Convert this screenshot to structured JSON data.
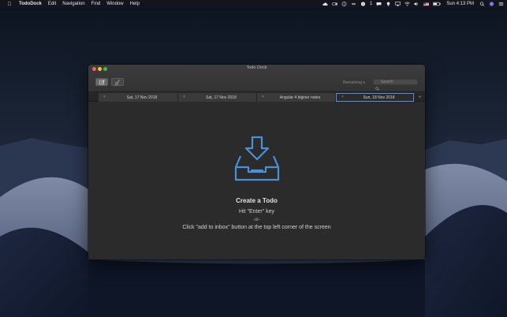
{
  "menubar": {
    "app_name": "TodoDock",
    "menus": [
      "Edit",
      "Navigation",
      "Find",
      "Window",
      "Help"
    ],
    "status_number": "1",
    "clock": "Sun 4:13 PM"
  },
  "window": {
    "title": "Todo Dock",
    "remaining_label": "Remaining",
    "remaining_arrow": "⇅",
    "search_placeholder": "Search",
    "tabs": [
      {
        "label": "Sat, 17 Nov 2018",
        "close": "×"
      },
      {
        "label": "Sat, 17 Nov 2018",
        "close": "×"
      },
      {
        "label": "Angular 4 biginer notes",
        "close": "×"
      },
      {
        "label": "Sun, 18 Nov 2018",
        "close": "×"
      }
    ],
    "add_tab": "+",
    "empty_state": {
      "title": "Create a Todo",
      "line1": "Hit \"Enter\" key",
      "line2": "-or-",
      "line3": "Click \"add to inbox\" button at the top left corner of the screen"
    }
  },
  "colors": {
    "accent_blue": "#4a90d9",
    "window_bg": "#2b2b2b",
    "close": "#fd5f57",
    "minimize": "#febc2e",
    "maximize": "#28c840"
  }
}
